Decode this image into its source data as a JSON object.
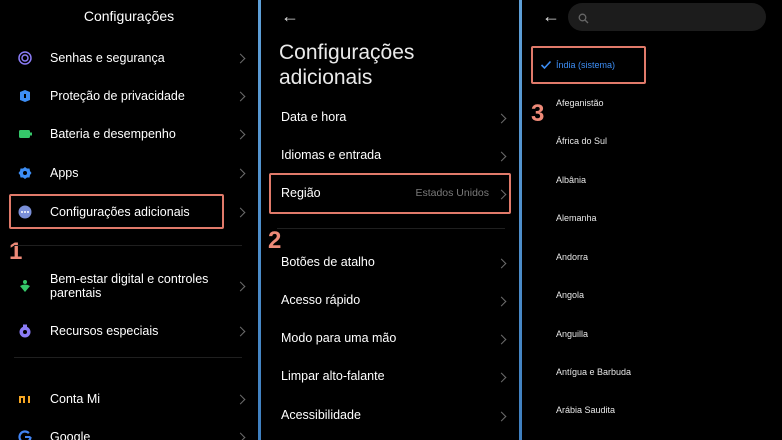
{
  "panel1": {
    "title": "Configurações",
    "items": [
      {
        "label": "Senhas e segurança",
        "icon": "fingerprint-icon",
        "color": "#8b7cf6"
      },
      {
        "label": "Proteção de privacidade",
        "icon": "privacy-shield-icon",
        "color": "#3d8ef5"
      },
      {
        "label": "Bateria e desempenho",
        "icon": "battery-icon",
        "color": "#35c86a"
      },
      {
        "label": "Apps",
        "icon": "gear-icon",
        "color": "#3d8ef5"
      },
      {
        "label": "Configurações adicionais",
        "icon": "more-dots-icon",
        "color": "#7a8fd8"
      },
      {
        "label": "Bem-estar digital e controles parentais",
        "icon": "wellbeing-heart-icon",
        "color": "#35c86a"
      },
      {
        "label": "Recursos especiais",
        "icon": "special-features-icon",
        "color": "#8b7cf6"
      },
      {
        "label": "Conta Mi",
        "icon": "mi-logo-icon",
        "color": "#f5a623"
      },
      {
        "label": "Google",
        "icon": "google-g-icon",
        "color": "#4285f4"
      }
    ],
    "step": "1"
  },
  "panel2": {
    "title_line1": "Configurações",
    "title_line2": "adicionais",
    "items": [
      {
        "label": "Data e hora",
        "value": ""
      },
      {
        "label": "Idiomas e entrada",
        "value": ""
      },
      {
        "label": "Região",
        "value": "Estados Unidos"
      },
      {
        "label": "Botões de atalho",
        "value": ""
      },
      {
        "label": "Acesso rápido",
        "value": ""
      },
      {
        "label": "Modo para uma mão",
        "value": ""
      },
      {
        "label": "Limpar alto-falante",
        "value": ""
      },
      {
        "label": "Acessibilidade",
        "value": ""
      }
    ],
    "step": "2"
  },
  "panel3": {
    "selected": "Índia (sistema)",
    "countries": [
      "Afeganistão",
      "África do Sul",
      "Albânia",
      "Alemanha",
      "Andorra",
      "Angola",
      "Anguilla",
      "Antígua e Barbuda",
      "Arábia Saudita"
    ],
    "step": "3"
  },
  "colors": {
    "highlight": "#e07a6a",
    "step_number": "#ee8a78",
    "accent": "#3d8ef5",
    "separator": "#5fa0d8"
  }
}
